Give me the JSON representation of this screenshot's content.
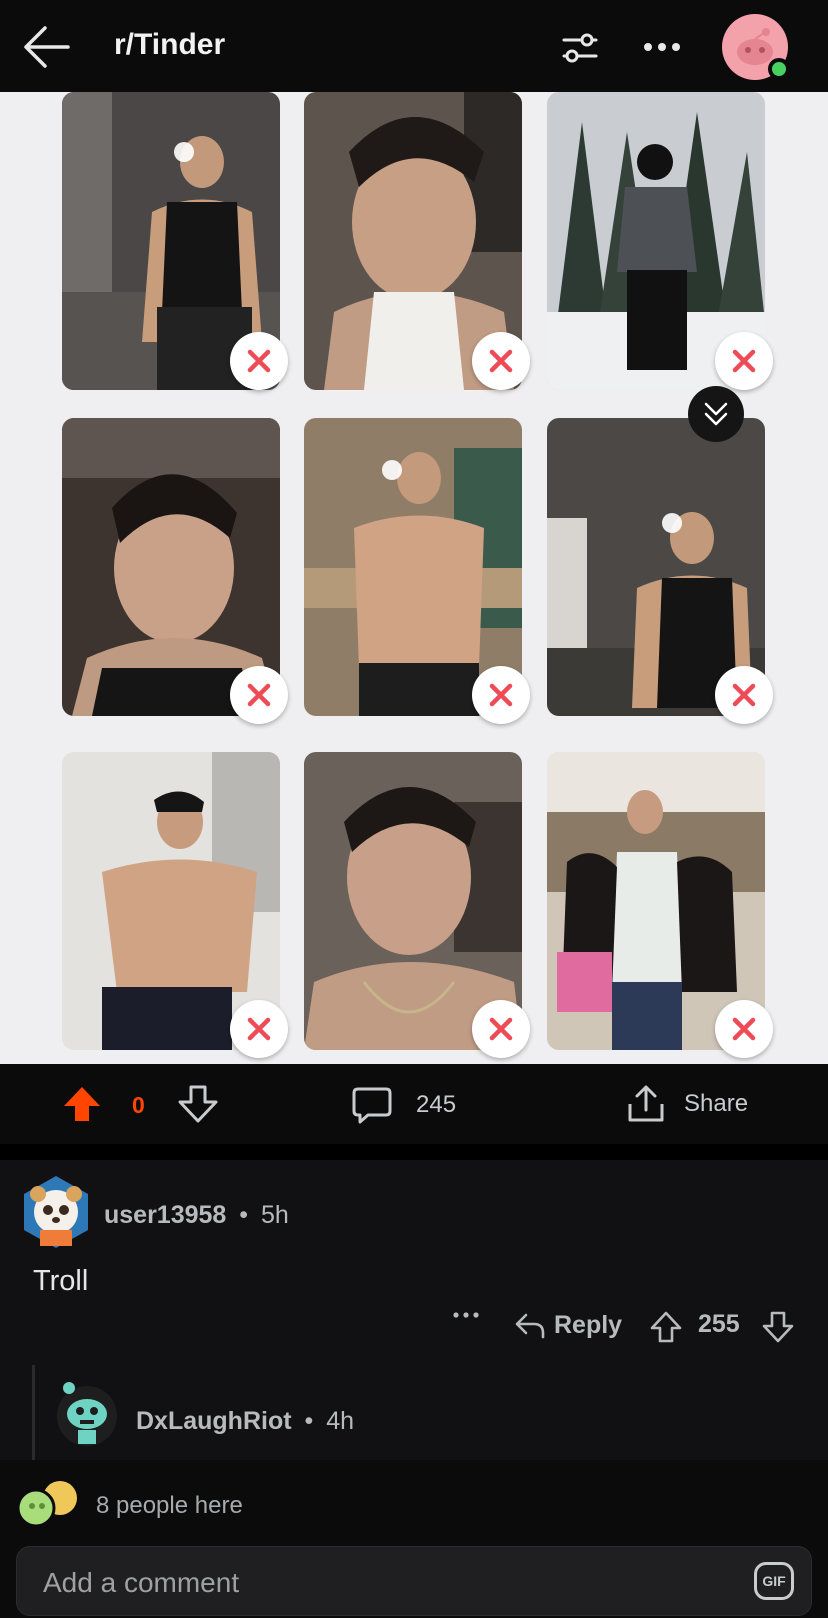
{
  "header": {
    "title": "r/Tinder",
    "back_icon": "arrow-left-icon",
    "filter_icon": "filter-sliders-icon",
    "more_icon": "more-horizontal-icon",
    "avatar_color": "#f3a1aa",
    "online_color": "#46d160"
  },
  "post": {
    "photos": [
      {
        "desc": "mirror selfie black tank"
      },
      {
        "desc": "close up white tank"
      },
      {
        "desc": "snow ski jacket"
      },
      {
        "desc": "close up black tank"
      },
      {
        "desc": "gym mirror shirtless"
      },
      {
        "desc": "bathroom mirror black tank"
      },
      {
        "desc": "kitchen shirtless cap"
      },
      {
        "desc": "close up shirtless"
      },
      {
        "desc": "group photo outdoor"
      }
    ],
    "vote_count": "0",
    "comment_count": "245",
    "share_label": "Share",
    "accent_color": "#ff4500"
  },
  "comment": {
    "username": "user13958",
    "separator": "•",
    "time": "5h",
    "body": "Troll",
    "reply_label": "Reply",
    "score": "255",
    "more_label": "•••"
  },
  "reply": {
    "username": "DxLaughRiot",
    "separator": "•",
    "time": "4h"
  },
  "presence": {
    "text": "8 people here"
  },
  "composer": {
    "placeholder": "Add a comment",
    "gif_label": "GIF"
  }
}
